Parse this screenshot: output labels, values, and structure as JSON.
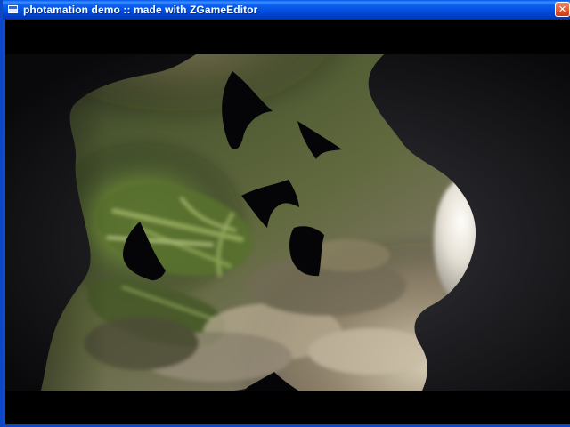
{
  "window": {
    "title": "photamation demo  :: made with ZGameEditor",
    "close_glyph": "✕"
  },
  "icons": {
    "app": "app-window-icon",
    "close": "close-icon"
  },
  "scene": {
    "description_visible": false,
    "watermark": "",
    "colors": {
      "background_dark": "#111115",
      "moss": "#627a38",
      "stone": "#9b8c72",
      "shadow": "#050508"
    }
  }
}
